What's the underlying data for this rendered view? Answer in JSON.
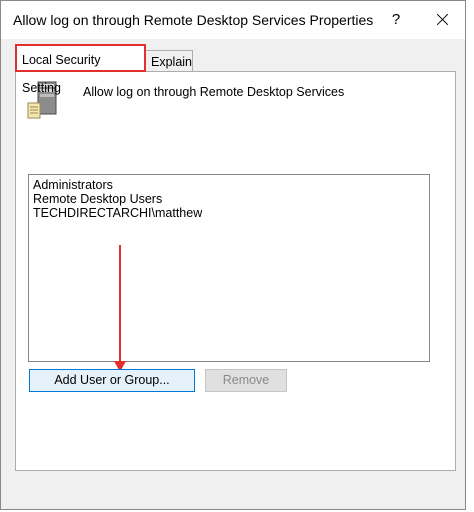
{
  "window": {
    "title": "Allow log on through Remote Desktop Services Properties",
    "help_label": "?",
    "close_icon": "close-icon"
  },
  "tabs": [
    {
      "label": "Local Security Setting",
      "selected": true,
      "highlighted": true
    },
    {
      "label": "Explain",
      "selected": false
    }
  ],
  "policy": {
    "icon": "server-icon",
    "name": "Allow log on through Remote Desktop Services"
  },
  "members": [
    "Administrators",
    "Remote Desktop Users",
    "TECHDIRECTARCHI\\matthew"
  ],
  "buttons": {
    "add_label": "Add User or Group...",
    "remove_label": "Remove",
    "remove_enabled": false
  },
  "annotation": {
    "arrow_color": "#e3302f",
    "highlight_color": "#e3302f"
  }
}
